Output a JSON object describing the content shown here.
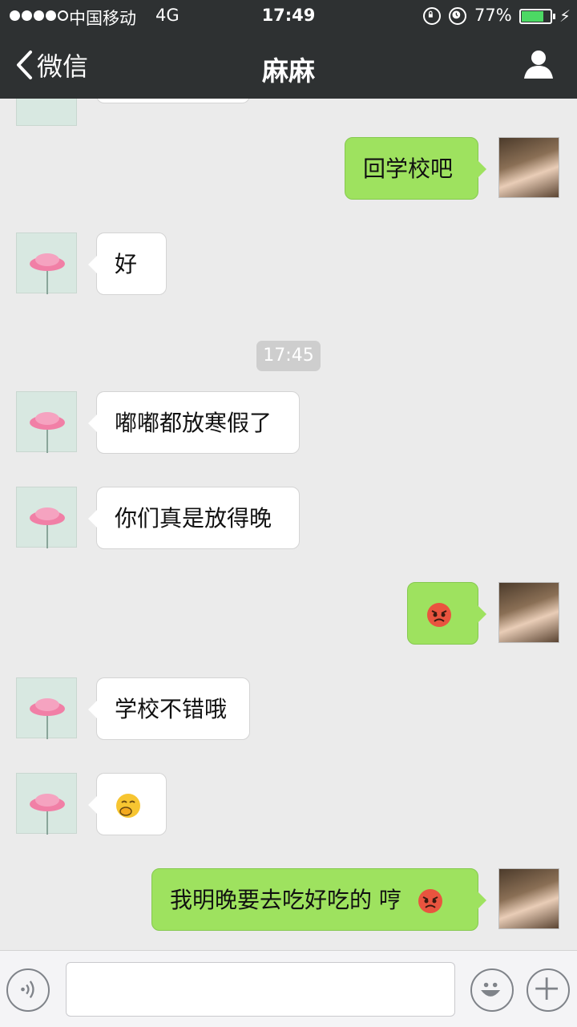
{
  "status_bar": {
    "carrier": "中国移动",
    "network": "4G",
    "time": "17:49",
    "battery": "77%",
    "battery_level": 0.77,
    "icons": [
      "signal-dots-icon",
      "orientation-lock-icon",
      "alarm-icon",
      "battery-icon",
      "charging-bolt-icon"
    ]
  },
  "nav": {
    "back_label": "微信",
    "title": "麻麻",
    "icons": [
      "back-chevron-icon",
      "person-icon"
    ]
  },
  "messages": [
    {
      "from": "me",
      "text": "回学校吧"
    },
    {
      "from": "mom",
      "text": "好"
    },
    {
      "type": "timestamp",
      "text": "17:45"
    },
    {
      "from": "mom",
      "text": "嘟嘟都放寒假了"
    },
    {
      "from": "mom",
      "text": "你们真是放得晚"
    },
    {
      "from": "me",
      "text": "",
      "emoji": "angry-face"
    },
    {
      "from": "mom",
      "text": "学校不错哦"
    },
    {
      "from": "mom",
      "text": "",
      "emoji": "snicker-face"
    },
    {
      "from": "me",
      "text": "我明晚要去吃好吃的 哼",
      "emoji": "angry-face"
    }
  ],
  "avatars": {
    "mom": "pink-flower-avatar",
    "me": "girl-portrait-avatar"
  },
  "input_bar": {
    "icons": [
      "voice-icon",
      "emoji-icon",
      "plus-icon"
    ],
    "placeholder": ""
  },
  "colors": {
    "header_bg": "#2e3132",
    "chat_bg": "#ebebeb",
    "my_bubble": "#9ee25f",
    "their_bubble": "#ffffff",
    "battery_fill": "#4cd964"
  }
}
